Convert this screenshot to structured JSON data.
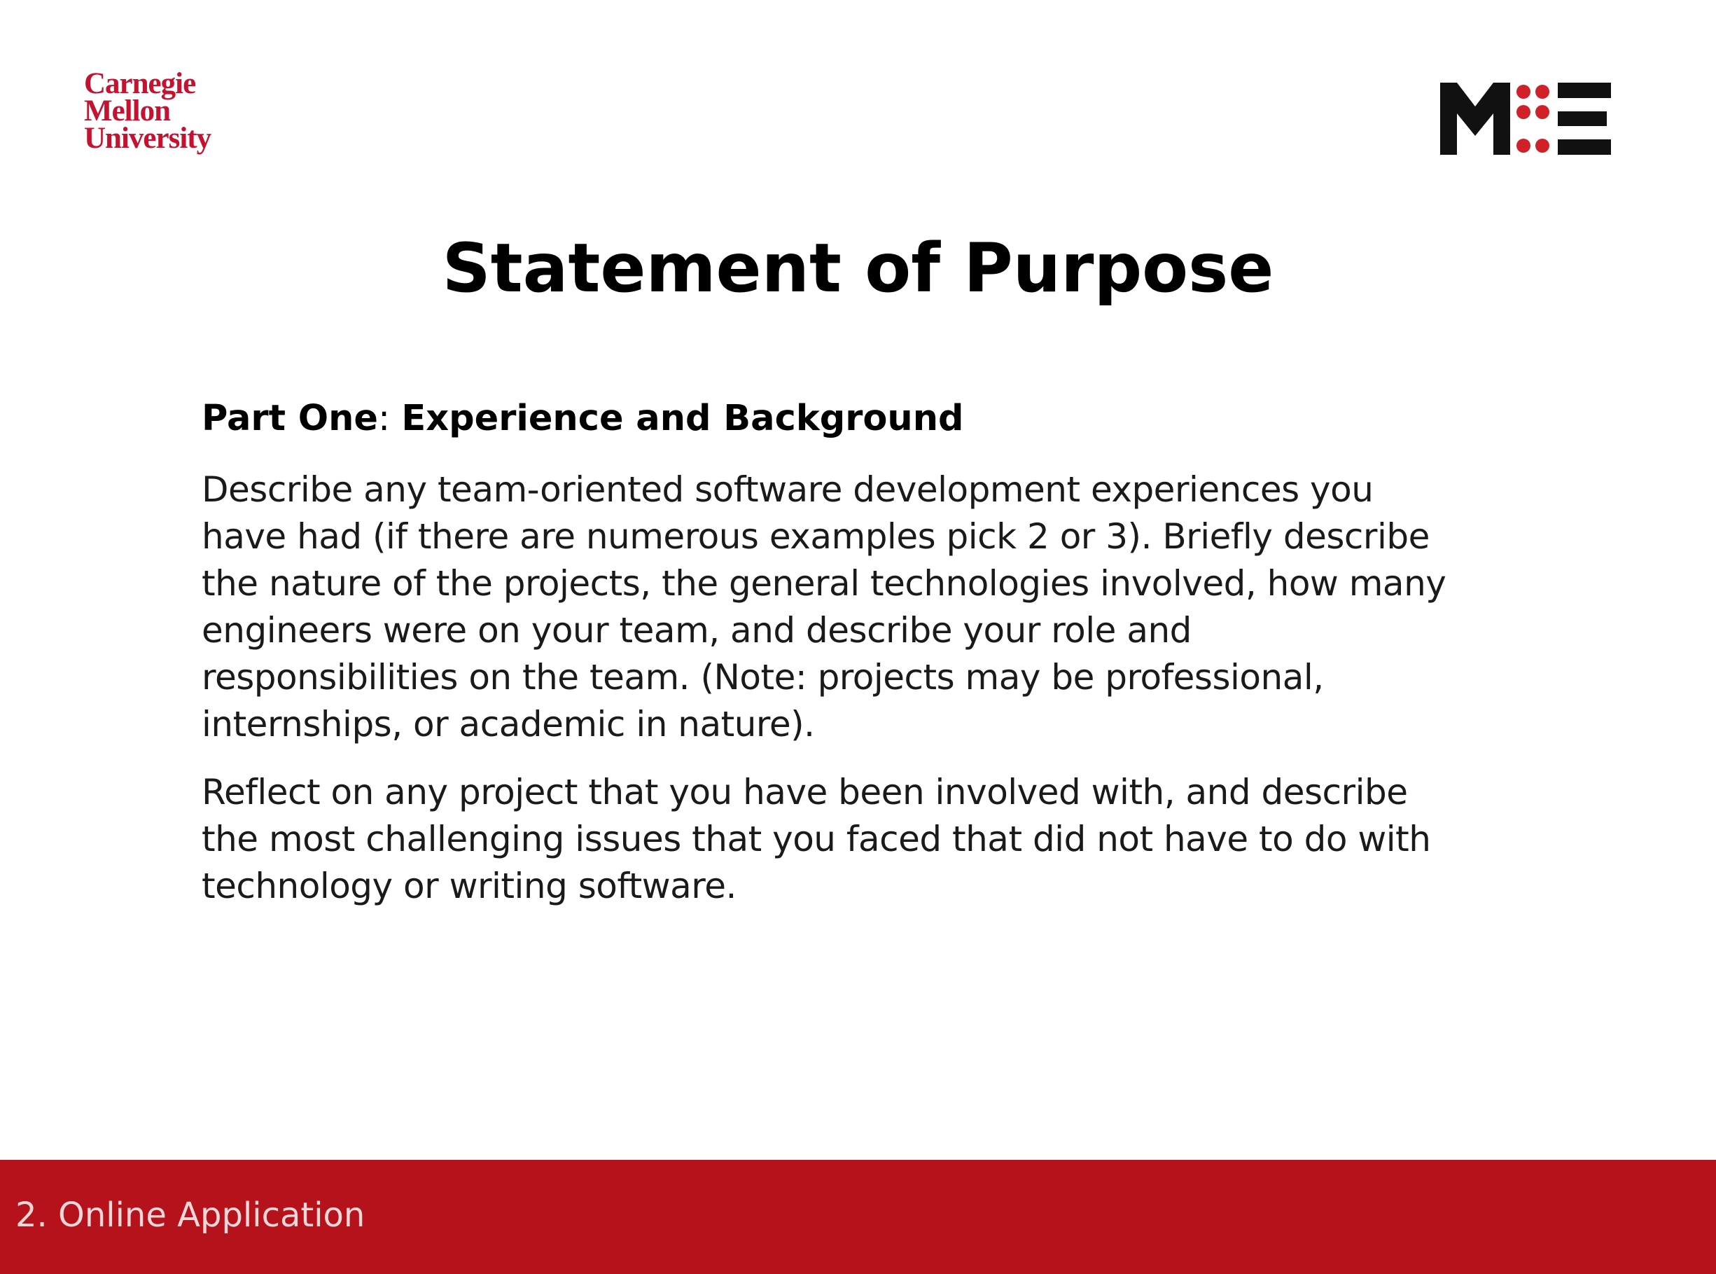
{
  "colors": {
    "brand_red": "#b5121b",
    "cmu_red": "#c41230",
    "logo_black": "#111111",
    "logo_dot_red": "#d0202a"
  },
  "logos": {
    "cmu": {
      "line1": "Carnegie",
      "line2": "Mellon",
      "line3": "University"
    },
    "mse": "M:E"
  },
  "slide": {
    "title": "Statement of Purpose",
    "part_heading": {
      "prefix": "Part One",
      "separator": ": ",
      "topic": "Experience and Background"
    },
    "paragraph1": {
      "lines": [
        "Describe any team-oriented software development experiences you",
        "have had (if there are numerous examples pick 2 or 3). Briefly describe",
        "the nature of the projects, the general technologies involved, how many",
        "engineers were on your team, and describe your role and",
        "responsibilities on the team. (Note: projects may be professional,",
        "internships, or academic in nature)."
      ]
    },
    "paragraph2": {
      "lines": [
        "Reflect on any project that you have been involved with, and describe",
        "the most challenging issues that you faced that did not have to do with",
        "technology or writing software."
      ]
    }
  },
  "footer": {
    "section_label": "2. Online Application"
  }
}
